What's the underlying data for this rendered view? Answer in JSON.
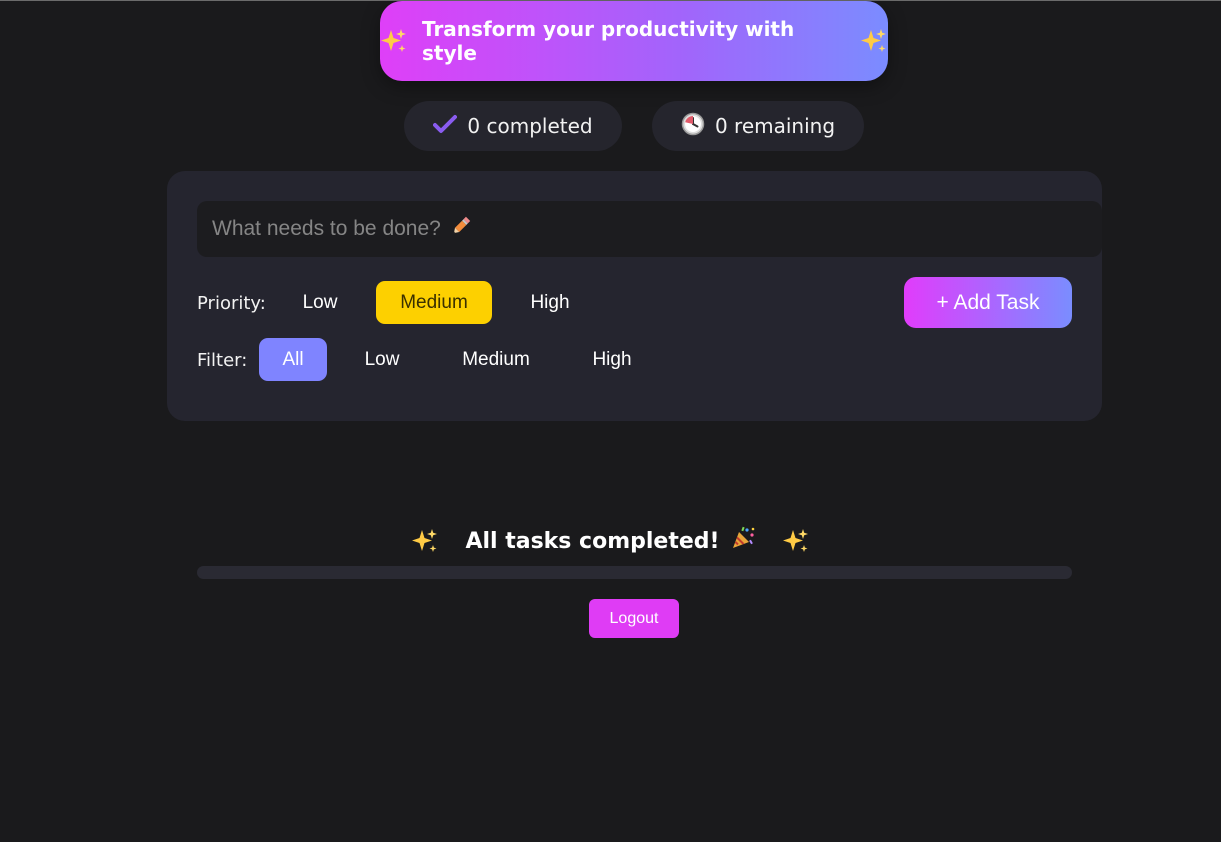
{
  "banner": {
    "title": "Transform your productivity with style",
    "left_icon": "sparkles-icon",
    "right_icon": "sparkles-icon"
  },
  "stats": {
    "completed_icon": "checkmark-icon",
    "completed_label": "0 completed",
    "remaining_icon": "clock-icon",
    "remaining_label": "0 remaining"
  },
  "task_form": {
    "input_value": "",
    "input_placeholder": "What needs to be done?",
    "input_icon": "pencil-icon",
    "priority_label": "Priority:",
    "priority_options": [
      "Low",
      "Medium",
      "High"
    ],
    "priority_selected": "Medium",
    "add_button_label": "+ Add Task",
    "filter_label": "Filter:",
    "filter_options": [
      "All",
      "Low",
      "Medium",
      "High"
    ],
    "filter_selected": "All"
  },
  "status": {
    "message": "All tasks completed!",
    "message_icon": "party-popper-icon",
    "progress_fraction": 0
  },
  "logout_label": "Logout",
  "colors": {
    "background": "#1a1a1c",
    "card": "#25252f",
    "accent_pink": "#df3cf5",
    "accent_blue": "#7f84ff",
    "priority_selected": "#fdd000"
  }
}
